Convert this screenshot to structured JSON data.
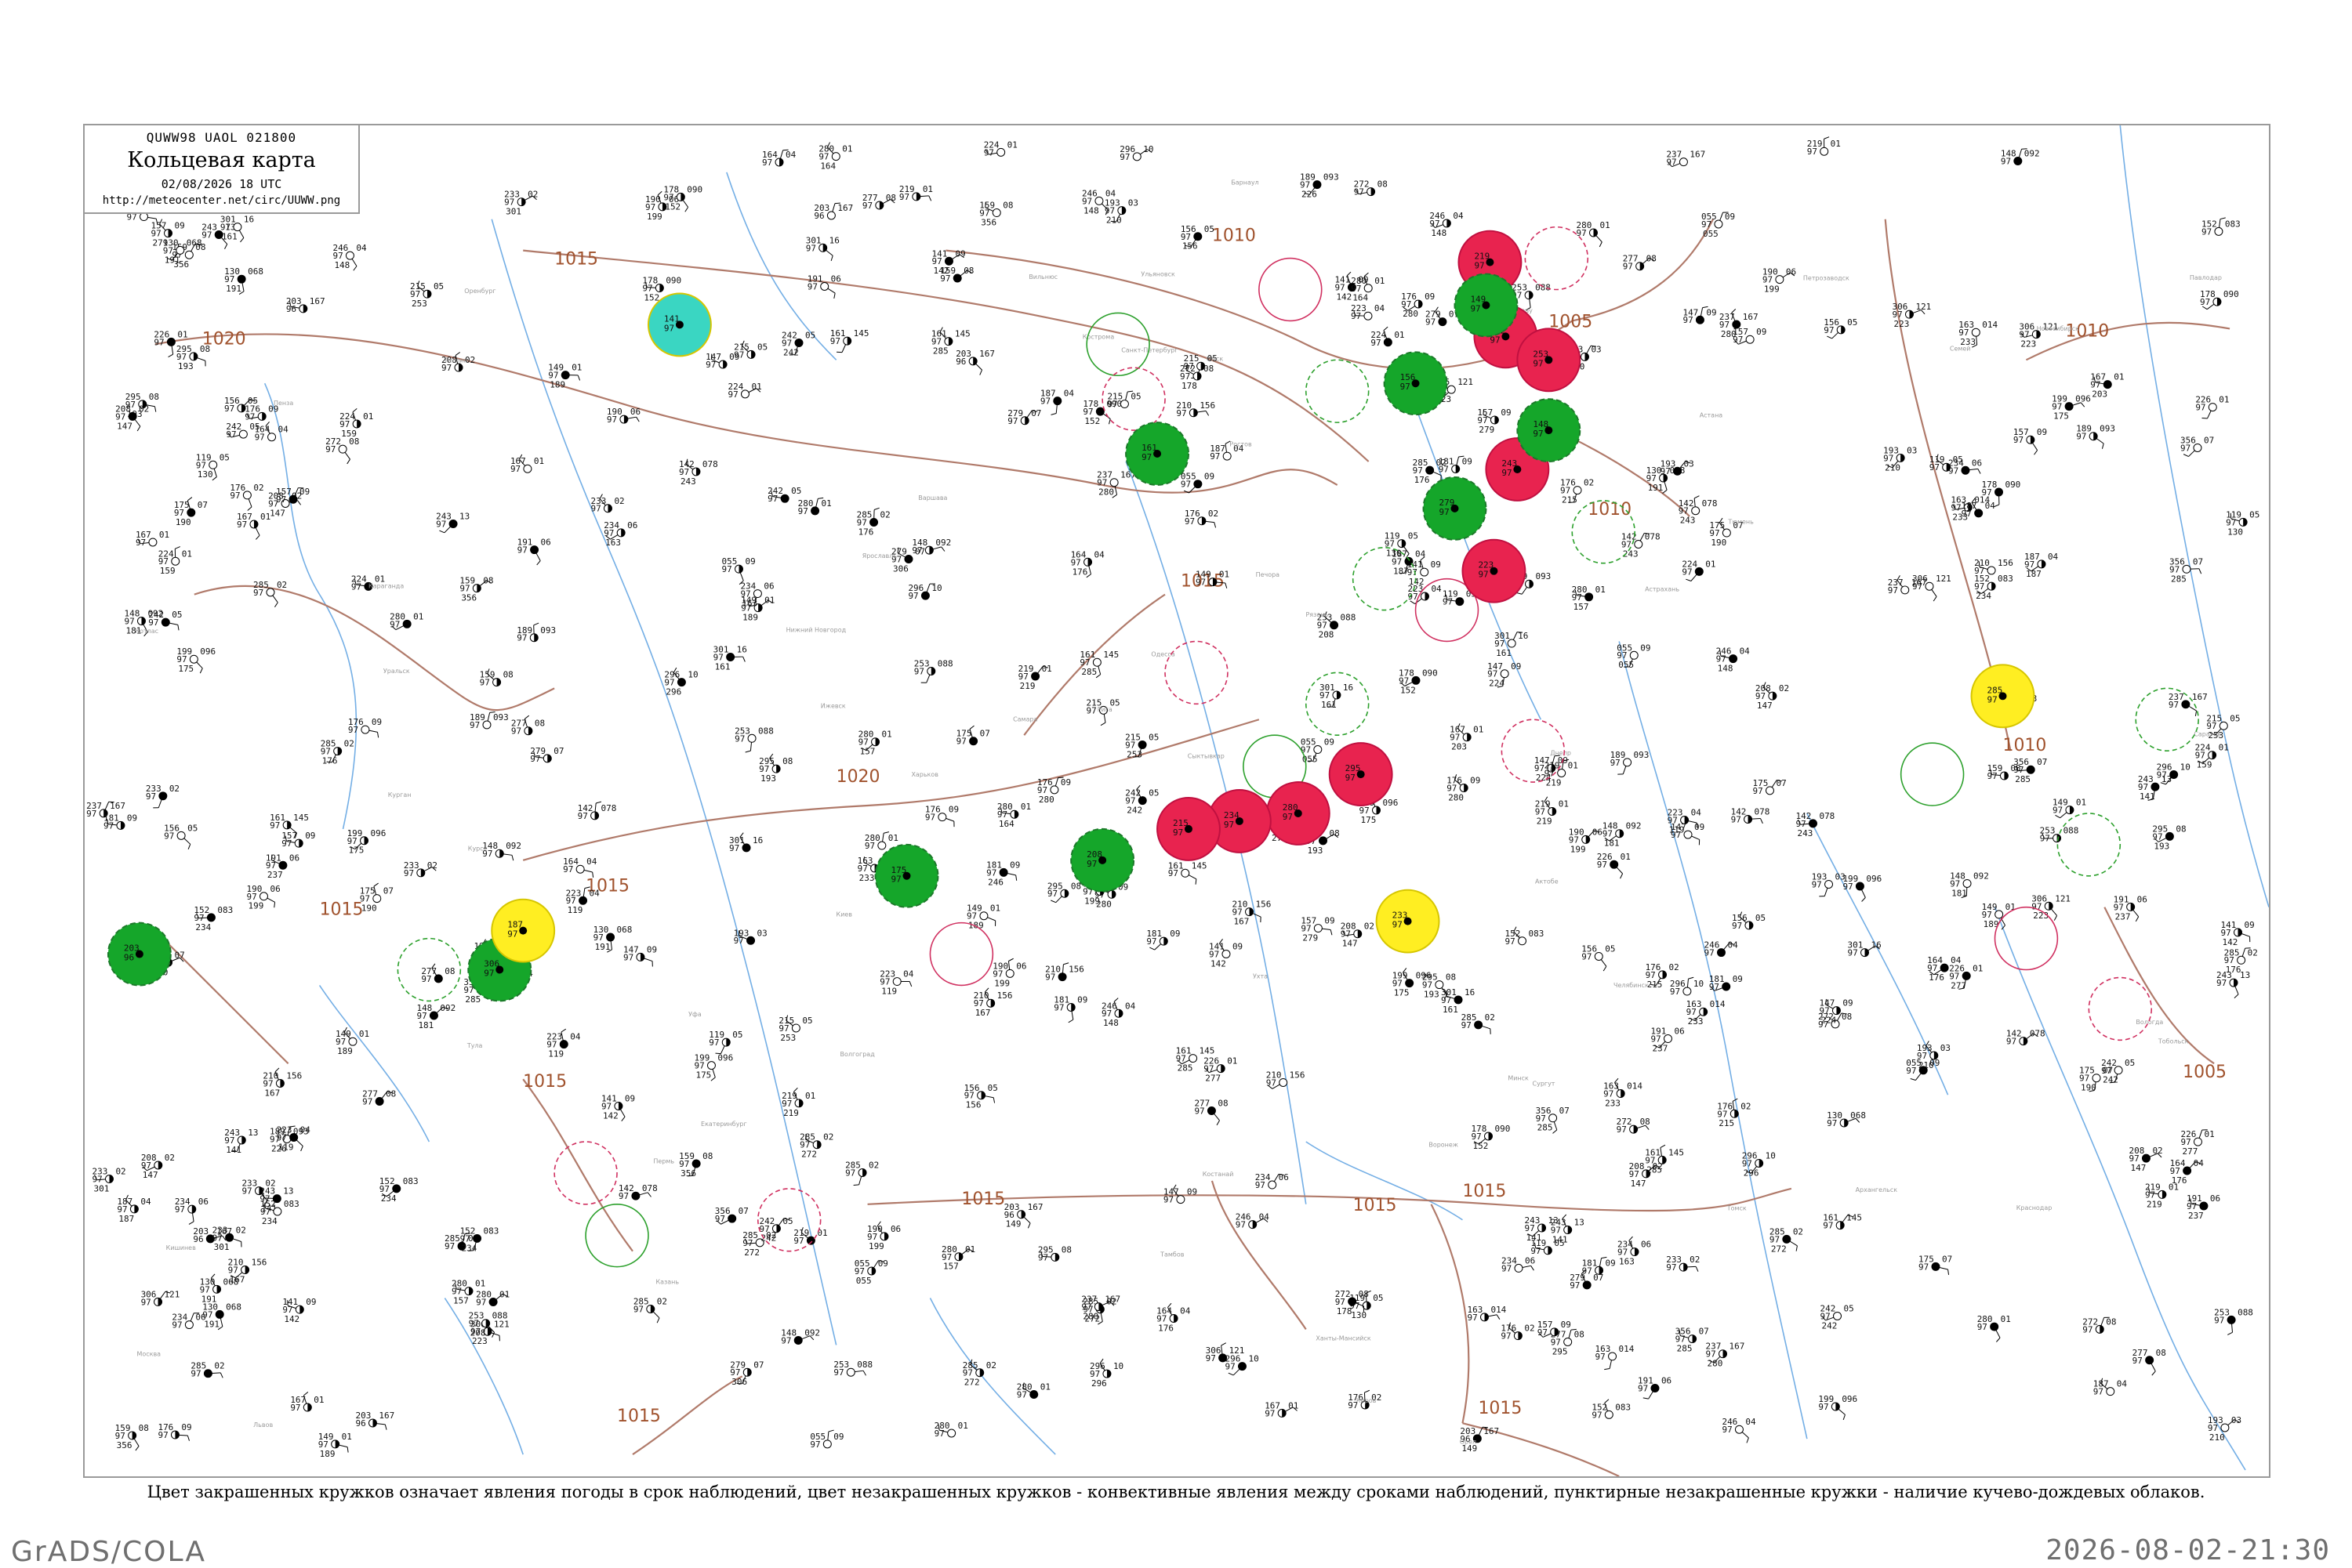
{
  "header": {
    "code_line": "QUWW98  UAOL  021800",
    "title": "Кольцевая карта",
    "datetime": "02/08/2026 18 UTC",
    "url": "http://meteocenter.net/circ/UUWW.png"
  },
  "caption": "Цвет закрашенных кружков означает явления погоды в срок наблюдений, цвет незакрашенных кружков - конвективные явления между сроками наблюдений, пунктирные незакрашенные кружки - наличие кучево-дождевых облаков.",
  "footer": {
    "left": "GrADS/COLA",
    "right": "2026-08-02-21:30"
  },
  "colors": {
    "isobar": "#b07a6a",
    "river": "#5aa0e0",
    "thunder_fill": "#e8234f",
    "shower_fill": "#15a62a",
    "fog_fill": "#ffee22",
    "rain_fill": "#3ad6c2",
    "convective_ring": "#d03060",
    "cb_ring": "#2ca02c"
  },
  "isobar_labels": [
    "1020",
    "1015",
    "1015",
    "1010",
    "1005",
    "1010",
    "1010",
    "1015",
    "1015",
    "1020",
    "1015",
    "1015",
    "1015",
    "1015",
    "1005",
    "1010",
    "1015",
    "1015"
  ],
  "stations": [
    {
      "t": "219",
      "p": "01",
      "v": "97"
    },
    {
      "t": "149",
      "p": "01",
      "v": "97"
    },
    {
      "t": "191",
      "p": "06",
      "v": "97"
    },
    {
      "t": "199",
      "p": "096",
      "v": "97"
    },
    {
      "t": "147",
      "p": "09",
      "v": "97"
    },
    {
      "t": "152",
      "p": "083",
      "v": "97"
    },
    {
      "t": "148",
      "p": "092",
      "v": "97"
    },
    {
      "t": "189",
      "p": "093",
      "v": "97"
    },
    {
      "t": "130",
      "p": "068",
      "v": "97"
    },
    {
      "t": "055",
      "p": "09",
      "v": "97"
    },
    {
      "t": "253",
      "p": "088",
      "v": "97"
    },
    {
      "t": "161",
      "p": "145",
      "v": "97"
    },
    {
      "t": "176",
      "p": "09",
      "v": "97"
    },
    {
      "t": "193",
      "p": "03",
      "v": "97"
    },
    {
      "t": "237",
      "p": "167",
      "v": "97"
    },
    {
      "t": "243",
      "p": "13",
      "v": "97"
    },
    {
      "t": "208",
      "p": "02",
      "v": "97"
    },
    {
      "t": "301",
      "p": "16",
      "v": "97"
    },
    {
      "t": "296",
      "p": "10",
      "v": "97"
    },
    {
      "t": "277",
      "p": "08",
      "v": "97"
    },
    {
      "t": "223",
      "p": "04",
      "v": "97"
    },
    {
      "t": "175",
      "p": "07",
      "v": "97"
    },
    {
      "t": "356",
      "p": "07",
      "v": "97"
    },
    {
      "t": "285",
      "p": "02",
      "v": "97"
    },
    {
      "t": "246",
      "p": "04",
      "v": "97"
    },
    {
      "t": "295",
      "p": "08",
      "v": "97"
    },
    {
      "t": "306",
      "p": "121",
      "v": "97"
    },
    {
      "t": "242",
      "p": "05",
      "v": "97"
    },
    {
      "t": "224",
      "p": "01",
      "v": "97"
    },
    {
      "t": "163",
      "p": "014",
      "v": "97"
    },
    {
      "t": "280",
      "p": "01",
      "v": "97"
    },
    {
      "t": "203",
      "p": "167",
      "v": "96"
    },
    {
      "t": "119",
      "p": "05",
      "v": "97"
    },
    {
      "t": "142",
      "p": "078",
      "v": "97"
    },
    {
      "t": "159",
      "p": "08",
      "v": "97"
    },
    {
      "t": "234",
      "p": "06",
      "v": "97"
    },
    {
      "t": "187",
      "p": "04",
      "v": "97"
    },
    {
      "t": "210",
      "p": "156",
      "v": "97"
    },
    {
      "t": "157",
      "p": "09",
      "v": "97"
    },
    {
      "t": "190",
      "p": "06",
      "v": "97"
    },
    {
      "t": "215",
      "p": "05",
      "v": "97"
    },
    {
      "t": "233",
      "p": "02",
      "v": "97"
    },
    {
      "t": "181",
      "p": "09",
      "v": "97"
    },
    {
      "t": "167",
      "p": "01",
      "v": "97"
    },
    {
      "t": "280",
      "p": "01",
      "v": "97"
    },
    {
      "t": "156",
      "p": "05",
      "v": "97"
    },
    {
      "t": "285",
      "p": "02",
      "v": "97"
    },
    {
      "t": "178",
      "p": "090",
      "v": "97"
    },
    {
      "t": "164",
      "p": "04",
      "v": "97"
    },
    {
      "t": "226",
      "p": "01",
      "v": "97"
    },
    {
      "t": "279",
      "p": "07",
      "v": "97"
    },
    {
      "t": "141",
      "p": "09",
      "v": "97"
    },
    {
      "t": "176",
      "p": "02",
      "v": "97"
    },
    {
      "t": "272",
      "p": "08",
      "v": "97"
    }
  ],
  "city_names": [
    "Печора",
    "Ухта",
    "Сыктывкар",
    "Вологда",
    "Кострома",
    "Ярославль",
    "Москва",
    "Тула",
    "Орел",
    "Курск",
    "Воронеж",
    "Саратов",
    "Самара",
    "Казань",
    "Пермь",
    "Уфа",
    "Оренбург",
    "Челябинск",
    "Курган",
    "Тюмень",
    "Омск",
    "Тобольск",
    "Ханты-Мансийск",
    "Сургут",
    "Томск",
    "Новосибирск",
    "Барнаул",
    "Киров",
    "Нижний Новгород",
    "Рязань",
    "Тамбов",
    "Пенза",
    "Ульяновск",
    "Екатеринбург",
    "Ижевск",
    "Астрахань",
    "Волгоград",
    "Ростов",
    "Краснодар",
    "Минск",
    "Вильнюс",
    "Рига",
    "Таллин",
    "Санкт-Петербург",
    "Петрозаводск",
    "Архангельск",
    "Котлас",
    "Киев",
    "Харьков",
    "Днепр",
    "Одесса",
    "Львов",
    "Варшава",
    "Кишинев",
    "Атырау",
    "Актобе",
    "Костанай",
    "Астана",
    "Павлодар",
    "Семей",
    "Караганда",
    "Уральск"
  ],
  "ring_stations": [
    {
      "kind": "thunder"
    },
    {
      "kind": "thunder"
    },
    {
      "kind": "thunder"
    },
    {
      "kind": "thunder"
    },
    {
      "kind": "thunder"
    },
    {
      "kind": "thunder"
    },
    {
      "kind": "thunder"
    },
    {
      "kind": "thunder"
    },
    {
      "kind": "thunder"
    },
    {
      "kind": "shower"
    },
    {
      "kind": "shower"
    },
    {
      "kind": "shower"
    },
    {
      "kind": "shower"
    },
    {
      "kind": "shower"
    },
    {
      "kind": "shower"
    },
    {
      "kind": "shower"
    },
    {
      "kind": "shower"
    },
    {
      "kind": "shower"
    },
    {
      "kind": "fog"
    },
    {
      "kind": "fog"
    },
    {
      "kind": "fog"
    },
    {
      "kind": "rain"
    }
  ]
}
